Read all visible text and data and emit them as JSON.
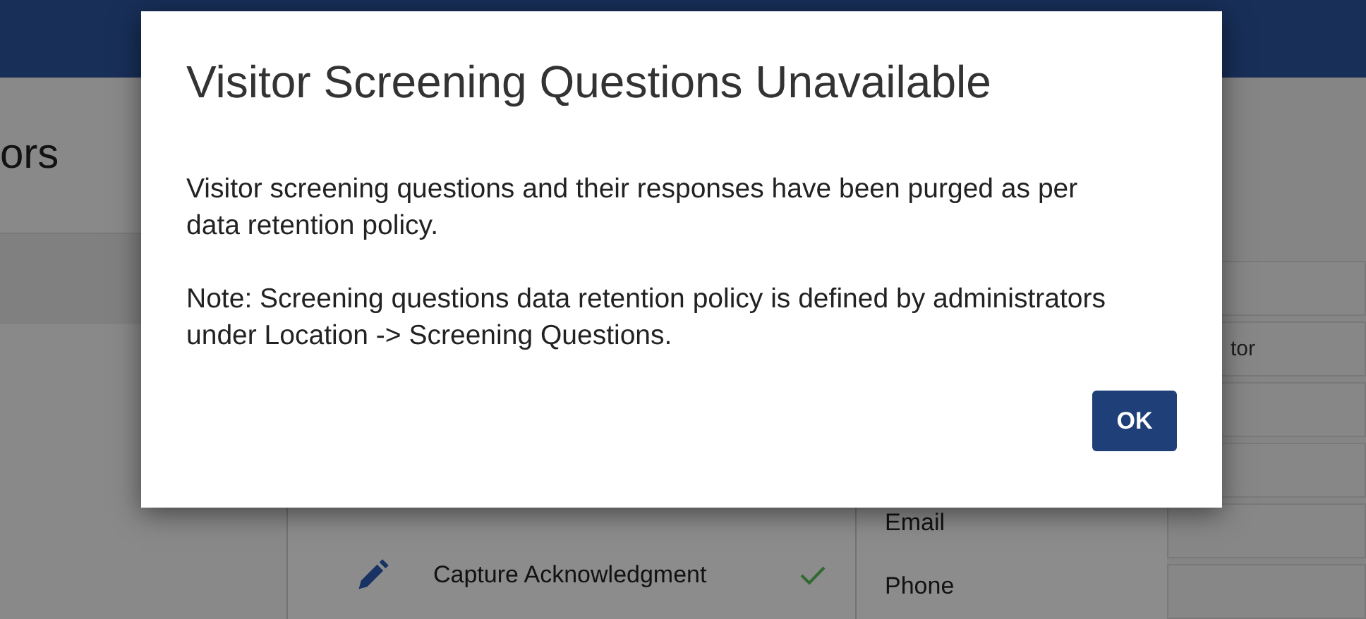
{
  "page": {
    "heading": "ors"
  },
  "steps": [
    {
      "label": "Capture Acknowledgment",
      "done": true
    }
  ],
  "fields": [
    "Email",
    "Phone"
  ],
  "side_field": {
    "value": "tor"
  },
  "dialog": {
    "title": "Visitor Screening Questions Unavailable",
    "paragraphs": [
      "Visitor screening questions and their responses have been purged as per data retention policy.",
      "Note: Screening questions data retention policy is defined by administrators under Location -> Screening Questions."
    ],
    "button": "OK"
  }
}
